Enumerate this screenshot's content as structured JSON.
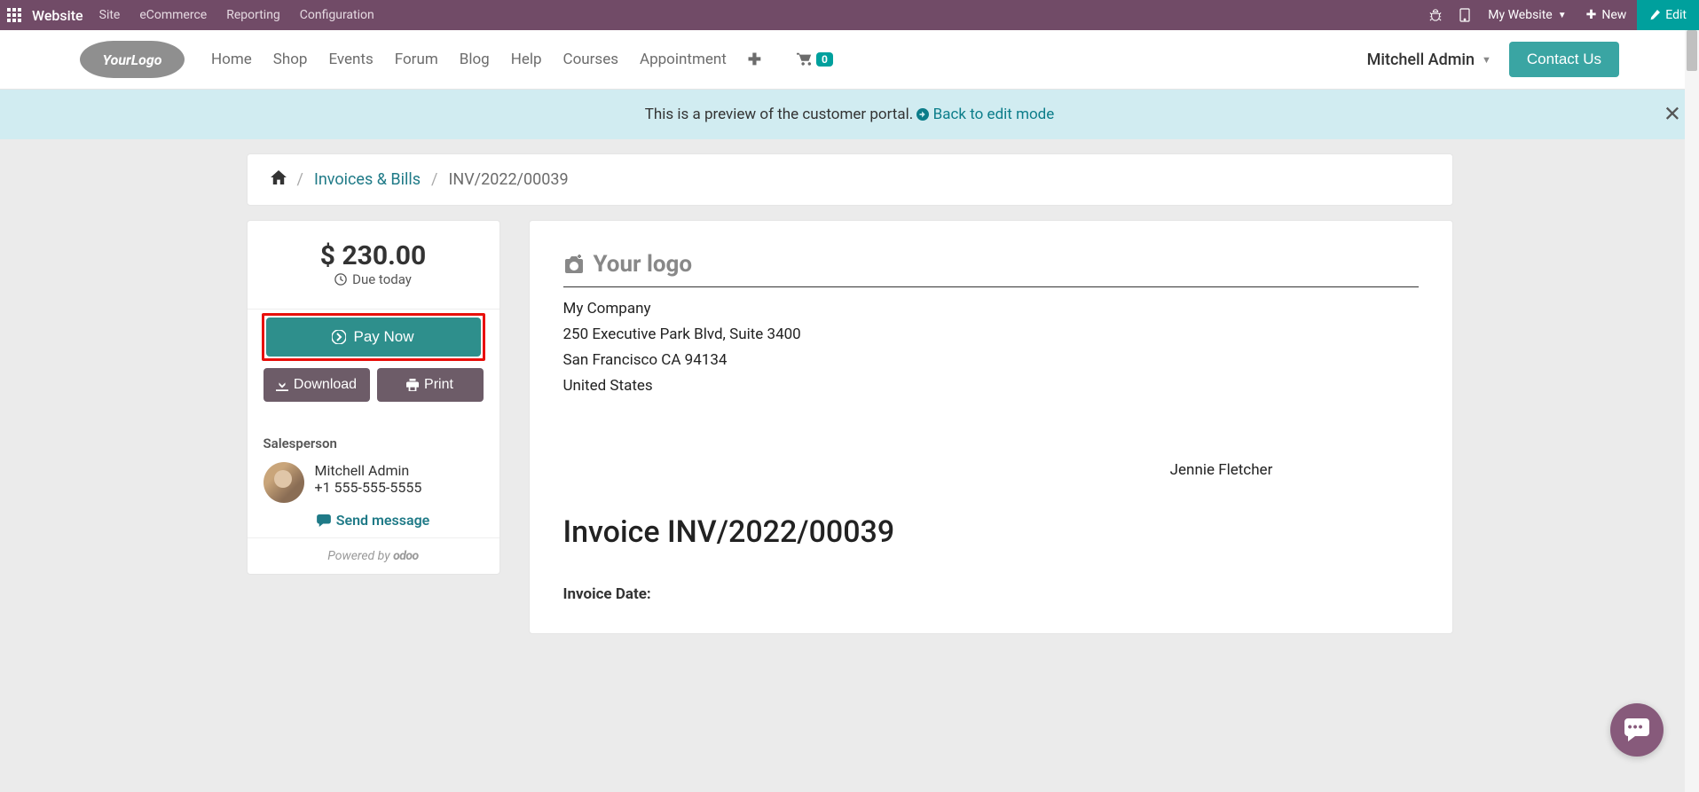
{
  "topbar": {
    "brand": "Website",
    "menu": [
      "Site",
      "eCommerce",
      "Reporting",
      "Configuration"
    ],
    "my_website": "My Website",
    "new": "New",
    "edit": "Edit"
  },
  "site_header": {
    "nav": [
      "Home",
      "Shop",
      "Events",
      "Forum",
      "Blog",
      "Help",
      "Courses",
      "Appointment"
    ],
    "cart_count": "0",
    "user": "Mitchell Admin",
    "contact": "Contact Us"
  },
  "preview": {
    "text": "This is a preview of the customer portal. ",
    "back": "Back to edit mode"
  },
  "breadcrumb": {
    "invoices": "Invoices & Bills",
    "current": "INV/2022/00039"
  },
  "sidebar": {
    "amount": "$ 230.00",
    "due": "Due today",
    "pay_now": "Pay Now",
    "download": "Download",
    "print": "Print",
    "salesperson_label": "Salesperson",
    "salesperson_name": "Mitchell Admin",
    "salesperson_phone": "+1 555-555-5555",
    "send_message": "Send message",
    "powered_prefix": "Powered by ",
    "powered_brand": "odoo"
  },
  "invoice": {
    "logo_text": "Your logo",
    "company": "My Company",
    "address1": "250 Executive Park Blvd, Suite 3400",
    "address2": "San Francisco CA 94134",
    "country": "United States",
    "customer": "Jennie Fletcher",
    "title": "Invoice INV/2022/00039",
    "date_label": "Invoice Date:"
  }
}
